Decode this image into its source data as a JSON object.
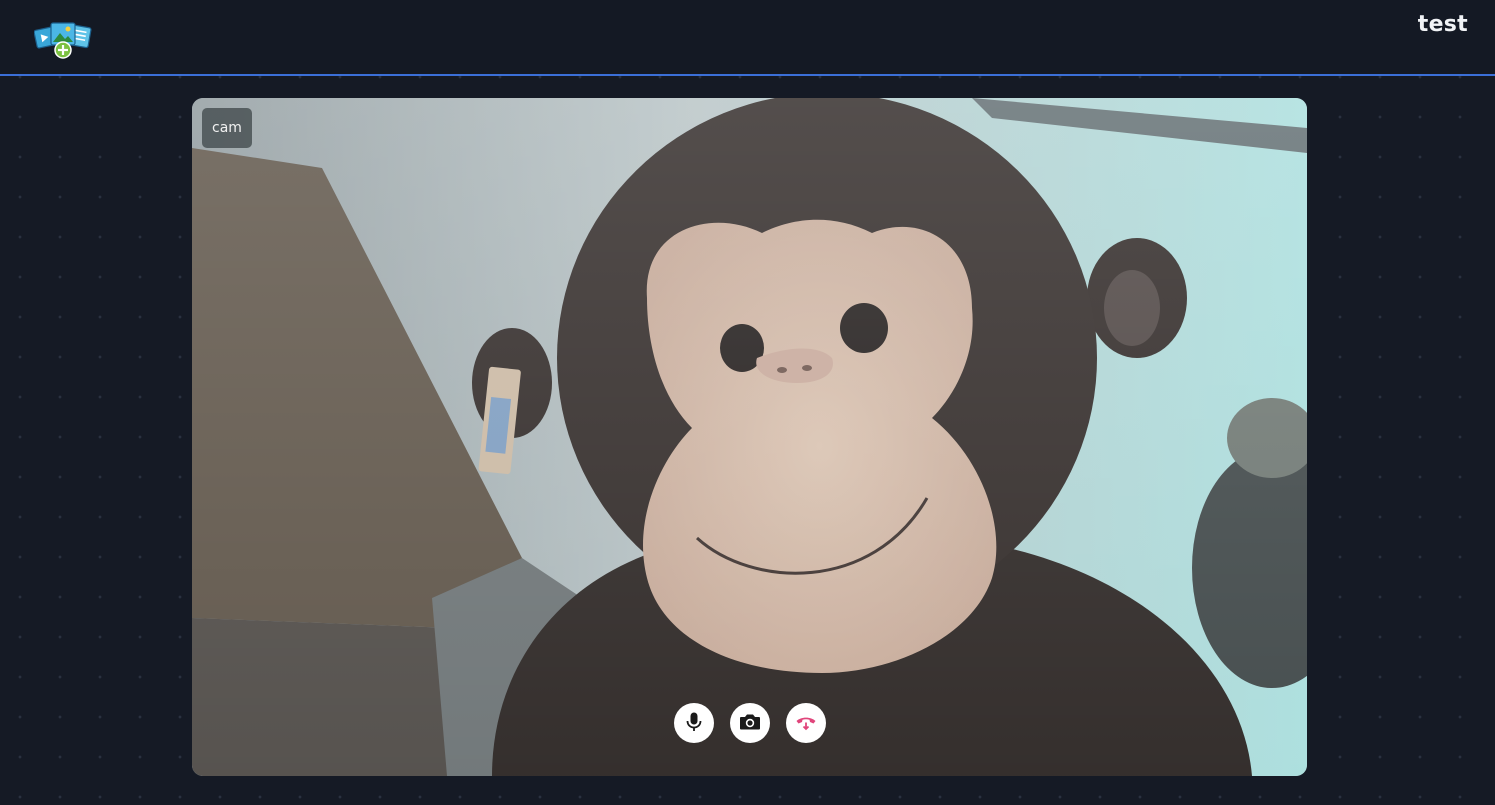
{
  "header": {
    "logo_icon": "media-gallery-add-icon",
    "user_name": "test"
  },
  "video": {
    "label": "cam"
  },
  "controls": [
    {
      "name": "microphone",
      "icon": "microphone-icon"
    },
    {
      "name": "camera",
      "icon": "camera-icon"
    },
    {
      "name": "hang-up",
      "icon": "phone-hangup-icon",
      "color": "#e0457b"
    }
  ],
  "colors": {
    "background": "#151a25",
    "accent_line": "#3b6fd8",
    "hangup": "#e0457b"
  }
}
